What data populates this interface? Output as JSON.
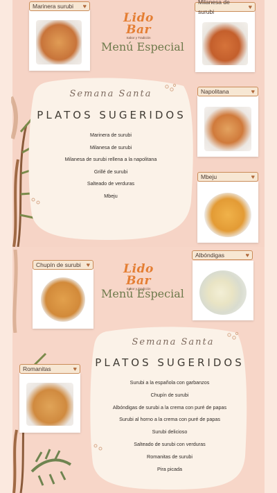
{
  "upper": {
    "brand": "Lido Bar",
    "tagline": "Sabor y Tradición",
    "special_title": "Menú Especial",
    "script_title": "Semana Santa",
    "heading": "PLATOS SUGERIDOS",
    "items": [
      "Marinera de surubi",
      "Milanesa de surubi",
      "Milanesa de surubi rellena a la napolitana",
      "Grillé de surubi",
      "Salteado de verduras",
      "Mbeju"
    ],
    "cards": {
      "marinera": "Marinera surubi",
      "milanesa": "Milanesa de surubi",
      "napolitana": "Napolitana",
      "mbeju": "Mbeju"
    }
  },
  "lower": {
    "brand": "Lido Bar",
    "tagline": "Sabor y Tradición",
    "special_title": "Menú Especial",
    "script_title": "Semana Santa",
    "heading": "PLATOS SUGERIDOS",
    "items": [
      "Surubi a la española con garbanzos",
      "Chupín de surubi",
      "Albóndigas de surubi a la crema con puré de papas",
      "Surubi al horno a la crema con puré de papas",
      "Surubi delicioso",
      "Salteado de surubi con verduras",
      "Romanitas de surubi",
      "Pira picada"
    ],
    "cards": {
      "chupin": "Chupín de surubi",
      "albondigas": "Albóndigas",
      "romanitas": "Romanitas"
    }
  },
  "icons": {
    "heart": "♥",
    "heart_icon_name": "heart-icon"
  },
  "colors": {
    "background": "#f4d3c4",
    "accent_orange": "#e47e33",
    "olive": "#6e7a4c",
    "tag_border": "#c98b57",
    "paper": "#fbf2e8"
  }
}
